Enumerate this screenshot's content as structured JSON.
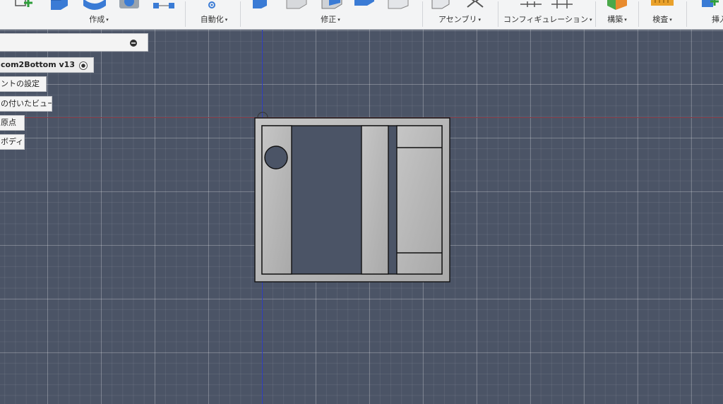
{
  "toolbar": {
    "groups": [
      {
        "label": "作成"
      },
      {
        "label": "自動化"
      },
      {
        "label": "修正"
      },
      {
        "label": "アセンブリ"
      },
      {
        "label": "コンフィギュレーション"
      },
      {
        "label": "構築"
      },
      {
        "label": "検査"
      },
      {
        "label": "挿入"
      }
    ],
    "caret": "▾"
  },
  "browser": {
    "root_name": "com2Bottom v13",
    "items": [
      {
        "label": "ントの設定"
      },
      {
        "label": "の付いたビュー"
      },
      {
        "label": "原点"
      },
      {
        "label": "ボディ"
      }
    ]
  },
  "colors": {
    "toolbar_bg": "#f3f4f5",
    "viewport_bg": "#4b5466",
    "grid_line": "#6e7686",
    "axis_x": "#8a3b46",
    "axis_y": "#2d3dbf",
    "model_face": "#b9b9b9",
    "model_outline": "#111111"
  },
  "icons": [
    "sketch-create-icon",
    "extrude-icon",
    "revolve-icon",
    "hole-icon",
    "pattern-icon",
    "automate-icon",
    "press-pull-icon",
    "fillet-icon",
    "chamfer-icon",
    "shell-icon",
    "draft-icon",
    "new-component-icon",
    "joint-icon",
    "config-table-icon",
    "config-rule-icon",
    "plane-icon",
    "measure-icon",
    "insert-icon"
  ]
}
